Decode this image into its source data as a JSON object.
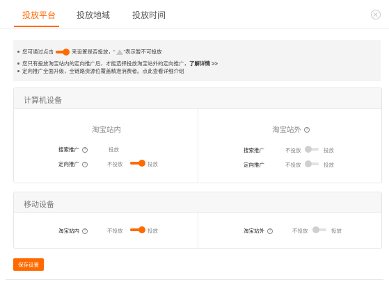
{
  "tabs": [
    {
      "label": "投放平台",
      "active": true
    },
    {
      "label": "投放地域",
      "active": false
    },
    {
      "label": "投放时间",
      "active": false
    }
  ],
  "notice": {
    "line1_prefix": "您可通过点击",
    "line1_suffix": "来设置是否投放，“",
    "line1_end": "”表示暂不可投放",
    "line2_text": "您只有投放淘宝站内的定向推广后，才能选择投放淘宝站外的定向推广，",
    "line2_link": "了解详情 >>",
    "line3_text": "定向推广全面升级，全链路资源位覆盖精准消费者。点此查看详细介绍"
  },
  "computer": {
    "title": "计算机设备",
    "inside": {
      "title": "淘宝站内",
      "rows": [
        {
          "label": "搜索推广",
          "value_text": "投放"
        },
        {
          "label": "定向推广",
          "off_text": "不投放",
          "on_text": "投放",
          "enabled": true
        }
      ]
    },
    "outside": {
      "title": "淘宝站外",
      "rows": [
        {
          "label": "搜索推广",
          "off_text": "不投放",
          "on_text": "投放",
          "enabled": false
        },
        {
          "label": "定向推广",
          "off_text": "不投放",
          "on_text": "投放",
          "enabled": false
        }
      ]
    }
  },
  "mobile": {
    "title": "移动设备",
    "inside": {
      "label": "淘宝站内",
      "off_text": "不投放",
      "on_text": "投放",
      "enabled": true
    },
    "outside": {
      "label": "淘宝站外",
      "off_text": "不投放",
      "on_text": "投放",
      "enabled": false
    }
  },
  "actions": {
    "save_label": "保存设置"
  },
  "colors": {
    "accent": "#ff6a00",
    "toggle_off": "#cfcfcf",
    "notice_bg": "#f4f4f4"
  },
  "icons": [
    "toggle-icon",
    "warning-triangle-icon",
    "help-circle-icon",
    "close-circle-icon"
  ]
}
